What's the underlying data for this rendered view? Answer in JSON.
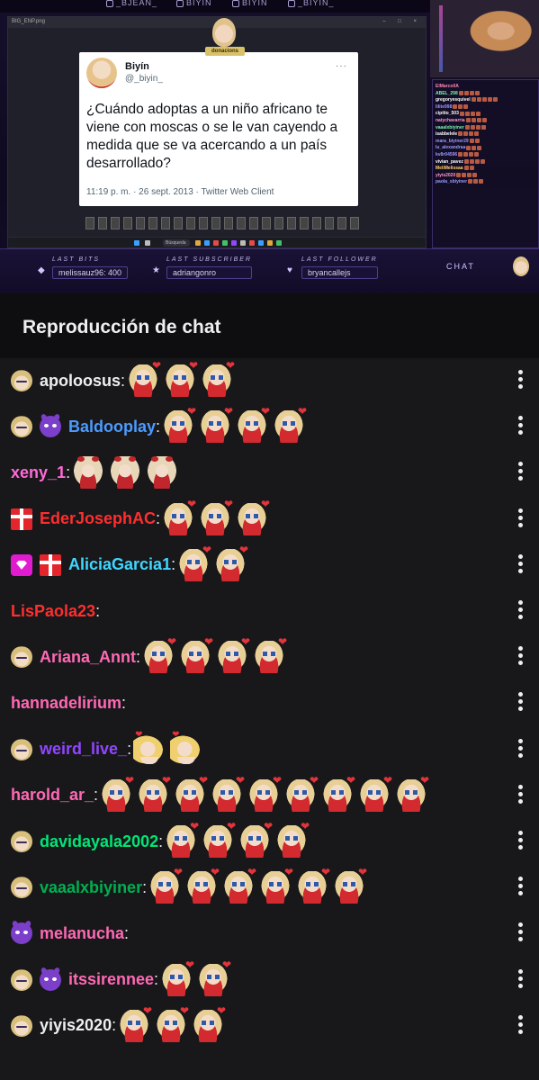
{
  "stream": {
    "socials": [
      "_BJEAN_",
      "BIYIN",
      "BIYIN",
      "_BIYIN_"
    ],
    "logo_badge": "donacions",
    "desktop": {
      "window_title": "BIG_ENP.png",
      "taskbar_search": "Búsqueda",
      "tweet": {
        "name": "Biyín",
        "handle": "@_biyin_",
        "text": "¿Cuándo adoptas a un niño africano te viene con moscas o se le van cayendo a medida que se va acercando a un país desarrollado?",
        "meta": "11:19 p. m. · 26 sept. 2013 · Twitter Web Client",
        "more": "···"
      }
    },
    "mini_chat": [
      {
        "user": "ElMarco0A",
        "color": "#ff8ab8",
        "emotes": 0
      },
      {
        "user": "ABEL_298",
        "color": "#7cf7b0",
        "emotes": 4
      },
      {
        "user": "gregoryesquivel",
        "color": "#ffffff",
        "emotes": 5
      },
      {
        "user": "lilite998",
        "color": "#9b9bff",
        "emotes": 3
      },
      {
        "user": "cipitio_503",
        "color": "#ffffff",
        "emotes": 4
      },
      {
        "user": "natychavarria",
        "color": "#ff9ad2",
        "emotes": 4
      },
      {
        "user": "vaaalxbiyiner",
        "color": "#7cf7b0",
        "emotes": 4
      },
      {
        "user": "isabbelele",
        "color": "#ffffff",
        "emotes": 4
      },
      {
        "user": "mara_biyiner29",
        "color": "#9b9bff",
        "emotes": 2
      },
      {
        "user": "lu_alexandraa",
        "color": "#9b9bff",
        "emotes": 3
      },
      {
        "user": "kv8r04596",
        "color": "#9b9bff",
        "emotes": 4
      },
      {
        "user": "vivian_pavez",
        "color": "#ffffff",
        "emotes": 4
      },
      {
        "user": "MeliMelissaa",
        "color": "#ffd36b",
        "emotes": 2
      },
      {
        "user": "yiyis2020",
        "color": "#ff9ad2",
        "emotes": 4
      },
      {
        "user": "paola_sbiyiner",
        "color": "#9b9bff",
        "emotes": 3
      }
    ],
    "bottom": {
      "last_bits_label": "LAST BITS",
      "last_bits_value": "melissauz96: 400",
      "last_sub_label": "LAST SUBSCRIBER",
      "last_sub_value": "adriangonro",
      "last_follower_label": "LAST FOLLOWER",
      "last_follower_value": "bryancallejs",
      "chat_label": "CHAT"
    }
  },
  "chat": {
    "title": "Reproducción de chat",
    "messages": [
      {
        "user": "apoloosus",
        "color": "#efeff1",
        "badges": [
          "head"
        ],
        "emotes": [
          "heart",
          "heart",
          "heart"
        ]
      },
      {
        "user": "Baldooplay",
        "color": "#4b9bff",
        "badges": [
          "head",
          "devil"
        ],
        "emotes": [
          "heart",
          "heart",
          "heart",
          "heart"
        ]
      },
      {
        "user": "xeny_1",
        "color": "#ff6ad5",
        "badges": [],
        "emotes": [
          "bow",
          "bow",
          "bow"
        ]
      },
      {
        "user": "EderJosephAC",
        "color": "#ff2e2e",
        "badges": [
          "gift"
        ],
        "emotes": [
          "heart",
          "heart",
          "heart"
        ]
      },
      {
        "user": "AliciaGarcia1",
        "color": "#3fd7ff",
        "badges": [
          "prime",
          "gift"
        ],
        "emotes": [
          "heart",
          "heart"
        ]
      },
      {
        "user": "LisPaola23",
        "color": "#ff2e2e",
        "badges": [],
        "emotes": []
      },
      {
        "user": "Ariana_Annt",
        "color": "#ff69b4",
        "badges": [
          "head"
        ],
        "emotes": [
          "heart",
          "heart",
          "heart",
          "heart"
        ]
      },
      {
        "user": "hannadelirium",
        "color": "#ff69b4",
        "badges": [],
        "emotes": []
      },
      {
        "user": "weird_live_",
        "color": "#9146ff",
        "badges": [
          "head"
        ],
        "emotes": [
          "love",
          "love"
        ]
      },
      {
        "user": "harold_ar_",
        "color": "#ff69b4",
        "badges": [],
        "emotes": [
          "heart",
          "heart",
          "heart",
          "heart",
          "heart",
          "heart",
          "heart",
          "heart",
          "heart"
        ]
      },
      {
        "user": "davidayala2002",
        "color": "#00e676",
        "badges": [
          "head"
        ],
        "emotes": [
          "heart",
          "heart",
          "heart",
          "heart"
        ]
      },
      {
        "user": "vaaalxbiyiner",
        "color": "#00b050",
        "badges": [
          "head"
        ],
        "emotes": [
          "heart",
          "heart",
          "heart",
          "heart",
          "heart",
          "heart"
        ]
      },
      {
        "user": "melanucha",
        "color": "#ff69b4",
        "badges": [
          "devil"
        ],
        "emotes": []
      },
      {
        "user": "itssirennee",
        "color": "#ff69b4",
        "badges": [
          "head",
          "devil"
        ],
        "emotes": [
          "heart",
          "heart"
        ]
      },
      {
        "user": "yiyis2020",
        "color": "#efeff1",
        "badges": [
          "head"
        ],
        "emotes": [
          "heart",
          "heart",
          "heart"
        ]
      }
    ]
  }
}
